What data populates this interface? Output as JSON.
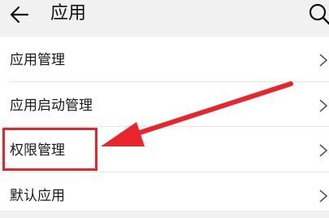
{
  "header": {
    "title": "应用",
    "back_icon": "arrow-left-icon",
    "search_icon": "search-icon"
  },
  "list": {
    "items": [
      {
        "label": "应用管理"
      },
      {
        "label": "应用启动管理"
      },
      {
        "label": "权限管理"
      },
      {
        "label": "默认应用"
      }
    ]
  },
  "annotation": {
    "color": "#e8252a",
    "highlighted_item": "权限管理"
  }
}
